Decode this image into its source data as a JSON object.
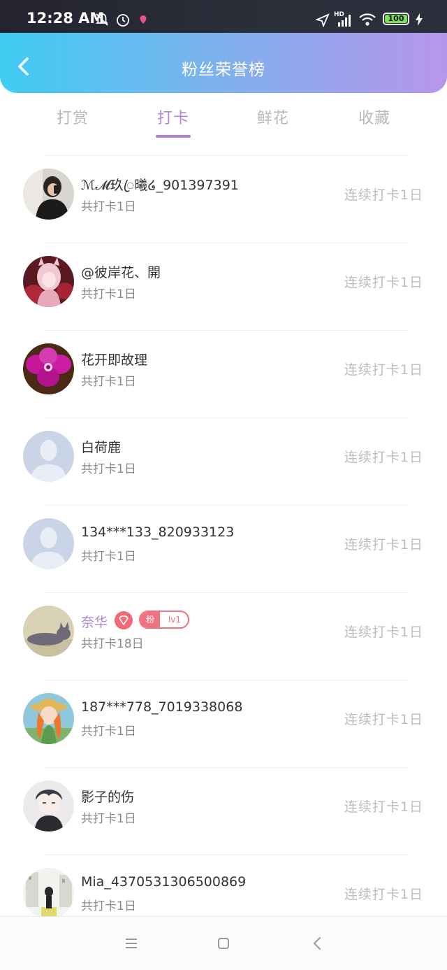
{
  "status_bar": {
    "time": "12:28 AM",
    "network_label": "HD",
    "battery": "100",
    "icons": [
      "mute-bell-icon",
      "alarm-icon",
      "location-dot-icon",
      "navigation-arrow-icon",
      "signal-icon",
      "wifi-icon",
      "battery-icon",
      "charging-icon"
    ]
  },
  "header": {
    "title": "粉丝荣誉榜",
    "back_icon": "back-arrow-icon"
  },
  "tabs": [
    {
      "label": "打赏",
      "active": false
    },
    {
      "label": "打卡",
      "active": true
    },
    {
      "label": "鲜花",
      "active": false
    },
    {
      "label": "收藏",
      "active": false
    }
  ],
  "rows": [
    {
      "name": "ℳ𝓜玖ꦿ曦໒_901397391",
      "sub": "共打卡1日",
      "streak": "连续打卡1日",
      "avatar": "photo-avatar-girl",
      "vip": false
    },
    {
      "name": "@彼岸花、開",
      "sub": "共打卡1日",
      "streak": "连续打卡1日",
      "avatar": "anime-avatar-pink",
      "vip": false
    },
    {
      "name": "花开即故理",
      "sub": "共打卡1日",
      "streak": "连续打卡1日",
      "avatar": "orchid-flower-avatar",
      "vip": false
    },
    {
      "name": "白荷鹿",
      "sub": "共打卡1日",
      "streak": "连续打卡1日",
      "avatar": "default-user-avatar",
      "vip": false
    },
    {
      "name": "134***133_820933123",
      "sub": "共打卡1日",
      "streak": "连续打卡1日",
      "avatar": "default-user-avatar",
      "vip": false
    },
    {
      "name": "奈华",
      "sub": "共打卡18日",
      "streak": "连续打卡1日",
      "avatar": "cat-photo-avatar",
      "vip": true,
      "fan_badge": {
        "left": "粉",
        "right": "lv1"
      }
    },
    {
      "name": "187***778_7019338068",
      "sub": "共打卡1日",
      "streak": "连续打卡1日",
      "avatar": "anime-avatar-hat-girl",
      "vip": false
    },
    {
      "name": "影子的伤",
      "sub": "共打卡1日",
      "streak": "连续打卡1日",
      "avatar": "anime-avatar-dark-hair",
      "vip": false
    },
    {
      "name": "Mia_4370531306500869",
      "sub": "共打卡1日",
      "streak": "连续打卡1日",
      "avatar": "illustration-avatar-street",
      "vip": false
    }
  ],
  "bottom_nav": {
    "icons": [
      "menu-lines-icon",
      "home-square-icon",
      "back-chevron-icon"
    ]
  },
  "colors": {
    "accent": "#b186dc",
    "header_gradient_start": "#3fcdf2",
    "header_gradient_end": "#b796ec",
    "badge_red": "#f07280"
  }
}
